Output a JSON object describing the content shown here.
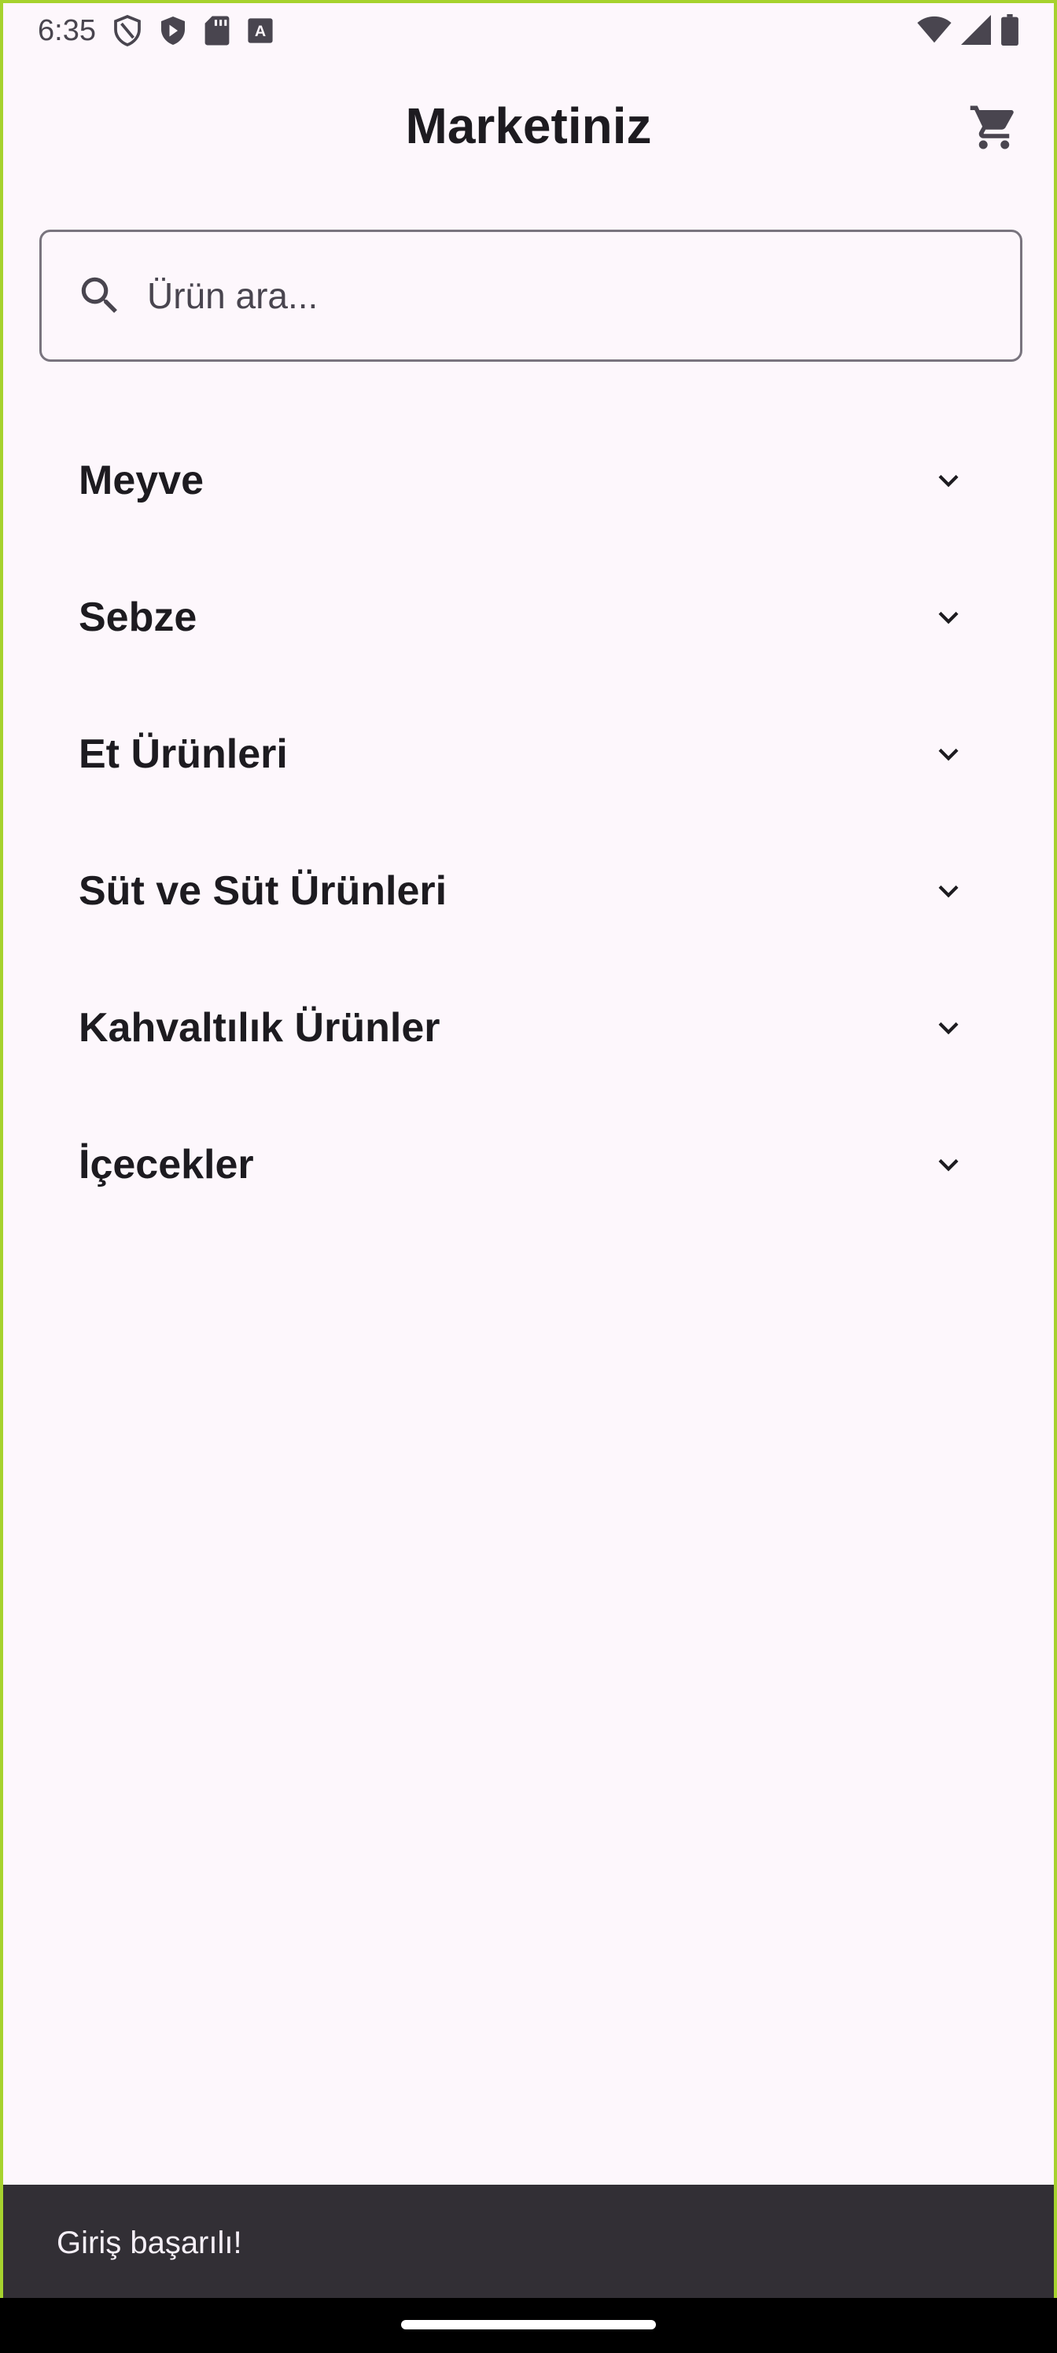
{
  "status_bar": {
    "time": "6:35",
    "left_icons": [
      "vpn-shield-icon",
      "shield-icon",
      "play-icon",
      "sd-card-icon",
      "keyboard-a-icon"
    ],
    "right_icons": [
      "wifi-icon",
      "signal-icon",
      "battery-icon"
    ]
  },
  "app_bar": {
    "title": "Marketiniz",
    "cart_icon": "cart-icon"
  },
  "search": {
    "placeholder": "Ürün ara...",
    "value": ""
  },
  "categories": [
    {
      "label": "Meyve"
    },
    {
      "label": "Sebze"
    },
    {
      "label": "Et Ürünleri"
    },
    {
      "label": "Süt ve Süt Ürünleri"
    },
    {
      "label": "Kahvaltılık Ürünler"
    },
    {
      "label": "İçecekler"
    }
  ],
  "snackbar": {
    "message": "Giriş başarılı!"
  },
  "colors": {
    "background": "#fdf7fc",
    "frame_border": "#a6d22e",
    "snackbar": "#322f35",
    "text": "#1d1b20"
  }
}
